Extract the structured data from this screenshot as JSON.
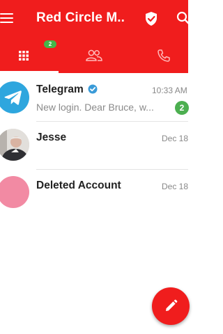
{
  "appbar": {
    "title": "Red Circle M..."
  },
  "tabs": {
    "badge_count": "2"
  },
  "chats": [
    {
      "name": "Telegram",
      "time": "10:33 AM",
      "preview": "New login. Dear Bruce, w...",
      "unread": "2",
      "verified": true
    },
    {
      "name": "Jesse",
      "time": "Dec 18"
    },
    {
      "name": "Deleted Account",
      "time": "Dec 18"
    }
  ],
  "colors": {
    "brand": "#f01d1d",
    "badge_green": "#4caf50",
    "telegram_blue": "#2ea6de",
    "deleted_avatar": "#f28aa3"
  }
}
